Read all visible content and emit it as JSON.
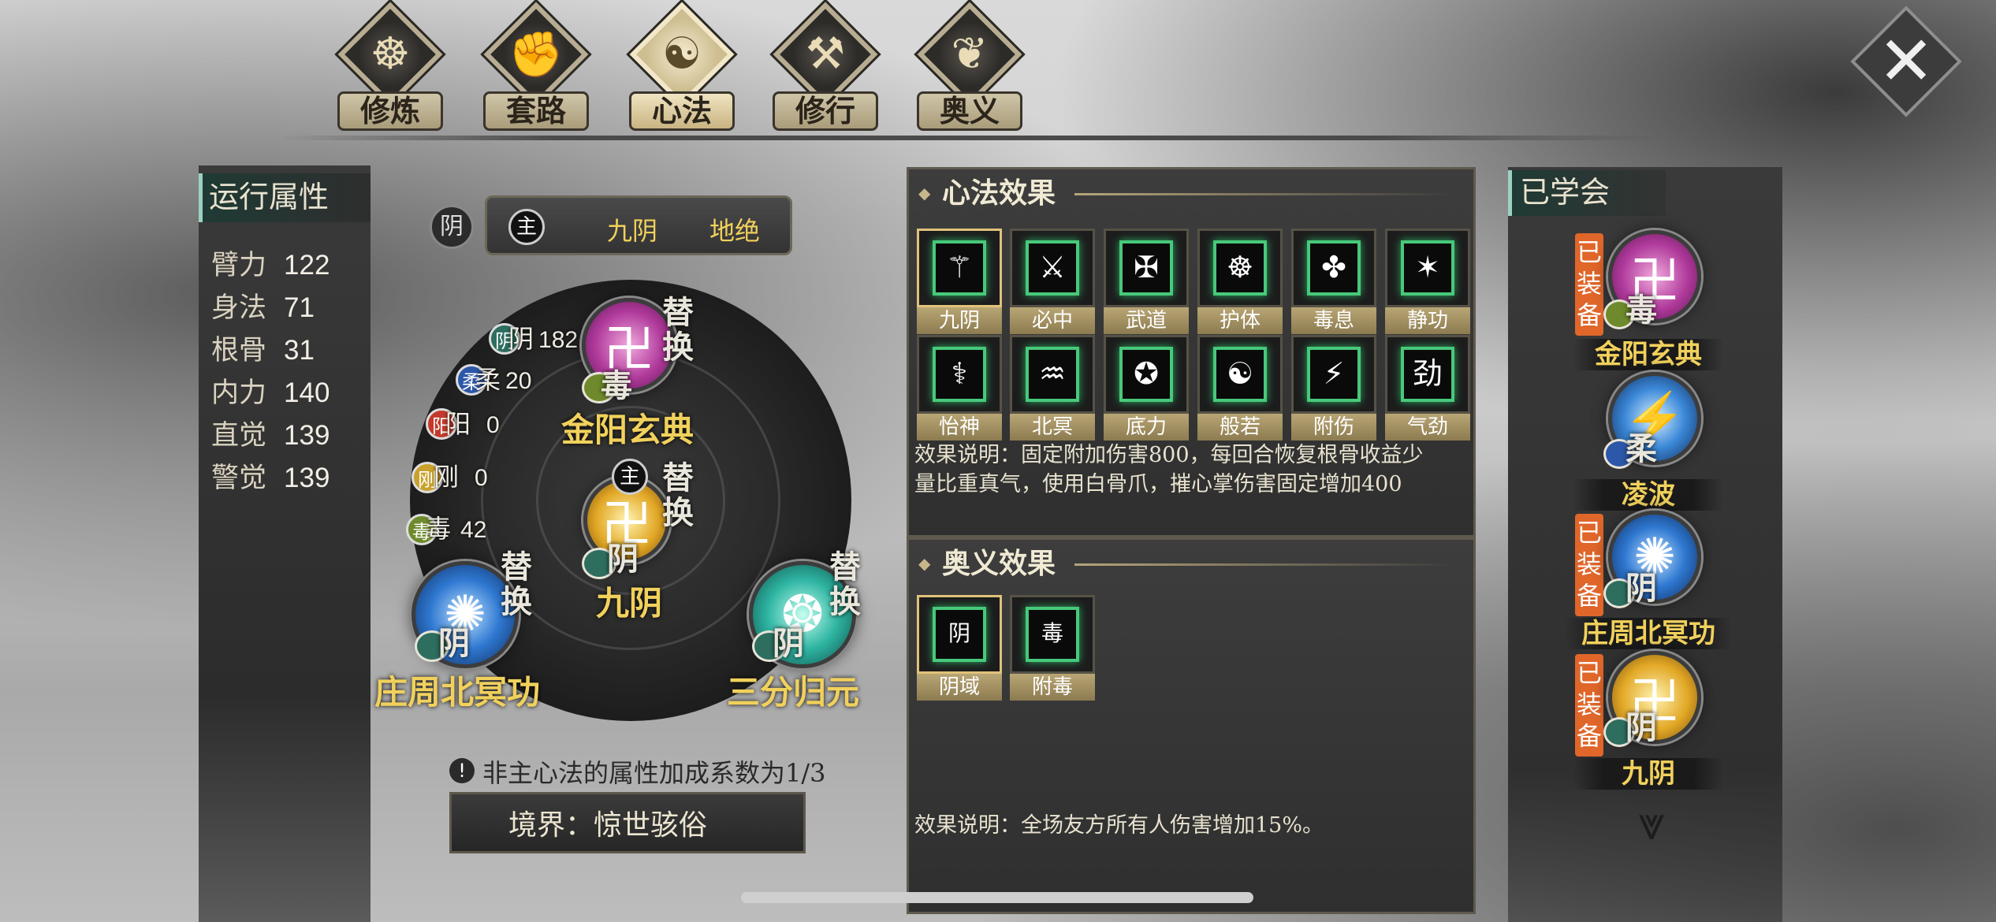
{
  "tabs": [
    {
      "label": "修炼",
      "icon": "swirl-icon"
    },
    {
      "label": "套路",
      "icon": "fist-icon"
    },
    {
      "label": "心法",
      "icon": "yinyang-icon",
      "active": true
    },
    {
      "label": "修行",
      "icon": "scroll-icon"
    },
    {
      "label": "奥义",
      "icon": "flame-icon"
    }
  ],
  "close_label": "✕",
  "left_panel": {
    "title": "运行属性",
    "stats": [
      {
        "name": "臂力",
        "value": "122"
      },
      {
        "name": "身法",
        "value": "71"
      },
      {
        "name": "根骨",
        "value": "31"
      },
      {
        "name": "内力",
        "value": "140"
      },
      {
        "name": "直觉",
        "value": "139"
      },
      {
        "name": "警觉",
        "value": "139"
      }
    ]
  },
  "center": {
    "yin_label": "阴",
    "main_label": "主",
    "header_name": "九阴",
    "header_tag": "地绝",
    "attrs": [
      {
        "chip": "阴",
        "name": "阴",
        "value": "182"
      },
      {
        "chip": "柔",
        "name": "柔",
        "value": "20"
      },
      {
        "chip": "阳",
        "name": "阳",
        "value": "0"
      },
      {
        "chip": "刚",
        "name": "刚",
        "value": "0"
      },
      {
        "chip": "毒",
        "name": "毒",
        "value": "42"
      }
    ],
    "replace_label": "替换",
    "slots": [
      {
        "name": "金阳玄典",
        "glyph": "卍",
        "badge": "毒"
      },
      {
        "name": "九阴",
        "glyph": "卍",
        "badge": "阴",
        "main": "主"
      },
      {
        "name": "庄周北冥功",
        "glyph": "✺",
        "badge": "阴"
      },
      {
        "name": "三分归元",
        "glyph": "❂",
        "badge": "阴"
      }
    ],
    "note": "非主心法的属性加成系数为1/3",
    "realm_label": "境界：惊世骇俗"
  },
  "effects": {
    "title": "心法效果",
    "skills": [
      {
        "label": "九阴",
        "glyph": "⚚"
      },
      {
        "label": "必中",
        "glyph": "⚔"
      },
      {
        "label": "武道",
        "glyph": "✠"
      },
      {
        "label": "护体",
        "glyph": "☸"
      },
      {
        "label": "毒息",
        "glyph": "✤"
      },
      {
        "label": "静功",
        "glyph": "✶"
      },
      {
        "label": "怡神",
        "glyph": "⚕"
      },
      {
        "label": "北冥",
        "glyph": "♒"
      },
      {
        "label": "底力",
        "glyph": "✪"
      },
      {
        "label": "般若",
        "glyph": "☯"
      },
      {
        "label": "附伤",
        "glyph": "⚡"
      },
      {
        "label": "气劲",
        "glyph": "劲"
      }
    ],
    "desc_line1": "效果说明：固定附加伤害800，每回合恢复根骨收益少",
    "desc_line2": "量比重真气，使用白骨爪，摧心掌伤害固定增加400"
  },
  "secret": {
    "title": "奥义效果",
    "skills": [
      {
        "label": "阴域",
        "glyph": "阴"
      },
      {
        "label": "附毒",
        "glyph": "毒"
      }
    ],
    "desc": "效果说明：全场友方所有人伤害增加15%。"
  },
  "learned": {
    "title": "已学会",
    "equipped_label": "已装备",
    "items": [
      {
        "name": "金阳玄典",
        "badge": "毒",
        "equipped": true
      },
      {
        "name": "凌波",
        "badge": "柔",
        "equipped": false
      },
      {
        "name": "庄周北冥功",
        "badge": "阴",
        "equipped": true
      },
      {
        "name": "九阴",
        "badge": "阴",
        "equipped": true
      }
    ],
    "more": "⩔"
  },
  "colors": {
    "gold": "#f1d15c",
    "green": "#47c97a",
    "orange": "#e0662a"
  }
}
